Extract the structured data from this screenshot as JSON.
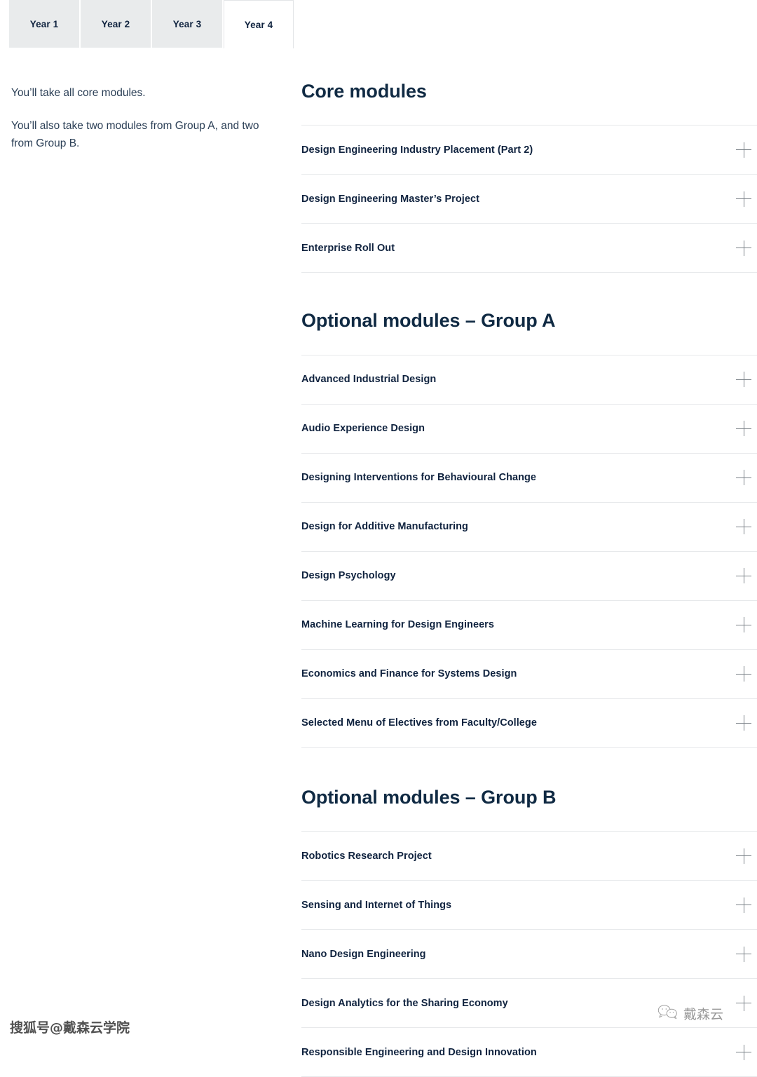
{
  "tabs": [
    {
      "label": "Year 1",
      "active": false
    },
    {
      "label": "Year 2",
      "active": false
    },
    {
      "label": "Year 3",
      "active": false
    },
    {
      "label": "Year 4",
      "active": true
    }
  ],
  "sidebar": {
    "paragraph_1": "You’ll take all core modules.",
    "paragraph_2": "You’ll also take two modules from Group A, and two from Group B."
  },
  "sections": [
    {
      "title": "Core modules",
      "modules": [
        "Design Engineering Industry Placement (Part 2)",
        "Design Engineering Master’s Project",
        "Enterprise Roll Out"
      ]
    },
    {
      "title": "Optional modules – Group A",
      "modules": [
        "Advanced Industrial Design",
        "Audio Experience Design",
        "Designing Interventions for Behavioural Change",
        "Design for Additive Manufacturing",
        "Design Psychology",
        "Machine Learning for Design Engineers",
        "Economics and Finance for Systems Design",
        "Selected Menu of Electives from Faculty/College"
      ]
    },
    {
      "title": "Optional modules – Group B",
      "modules": [
        "Robotics Research Project",
        "Sensing and Internet of Things",
        "Nano Design Engineering",
        "Design Analytics for the Sharing Economy",
        "Responsible Engineering and Design Innovation"
      ]
    }
  ],
  "watermarks": {
    "bottom_left": "搜狐号@戴森云学院",
    "bottom_right": "戴森云"
  },
  "icons": {
    "expand": "plus-icon",
    "wechat": "wechat-icon"
  },
  "colors": {
    "heading": "#102a43",
    "module_text": "#10233f",
    "body_text": "#2b3f56",
    "divider": "#e7e9eb",
    "tab_inactive_bg": "#e9ebec",
    "tab_active_bg": "#ffffff",
    "plus_icon": "#7b8288"
  }
}
